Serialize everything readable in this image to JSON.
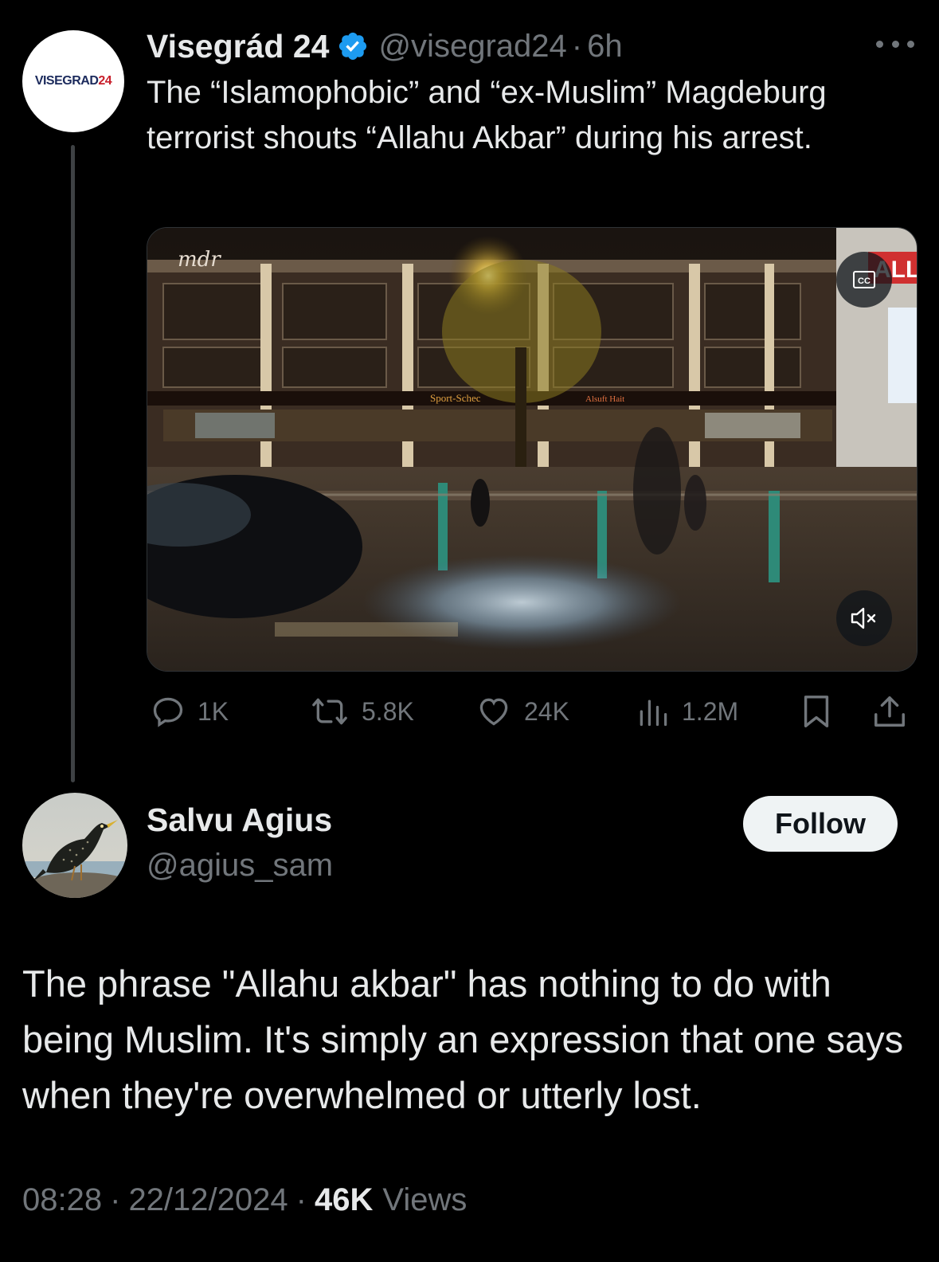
{
  "quoted_tweet": {
    "author_name": "Visegrád 24",
    "handle": "@visegrad24",
    "separator": "·",
    "age": "6h",
    "avatar_logo_text": "VISEGRAD",
    "avatar_logo_num": "24",
    "text": "The “Islamophobic” and “ex-Muslim” Magdeburg terrorist shouts “Allahu Akbar” during his arrest.",
    "video": {
      "watermark": "mdr",
      "sign_left": "Sport-Schec",
      "sign_right": "Alsuft Hait",
      "sign_far_right": "ALL"
    },
    "actions": {
      "replies": "1K",
      "reposts": "5.8K",
      "likes": "24K",
      "views": "1.2M"
    }
  },
  "reply_tweet": {
    "author_name": "Salvu Agius",
    "handle": "@agius_sam",
    "follow_label": "Follow",
    "text": "The phrase \"Allahu akbar\" has nothing to do with being Muslim. It's simply an expression that one says when they're overwhelmed or utterly lost.",
    "time": "08:28",
    "date": "22/12/2024",
    "separator": "·",
    "views_count": "46K",
    "views_label": "Views"
  },
  "colors": {
    "background": "#000000",
    "primary_text": "#e7e9ea",
    "secondary_text": "#71767b",
    "verified_blue": "#1d9bf0",
    "follow_button_bg": "#eff3f4"
  },
  "icons": [
    "more-icon",
    "verified-badge-icon",
    "cc-icon",
    "mute-icon",
    "reply-icon",
    "retweet-icon",
    "like-icon",
    "views-icon",
    "bookmark-icon",
    "share-icon"
  ]
}
